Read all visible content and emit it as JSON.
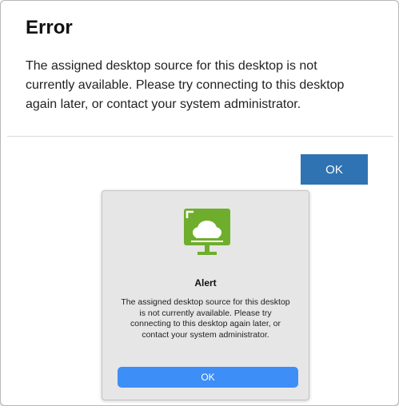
{
  "web_dialog": {
    "title": "Error",
    "message": "The assigned desktop source for this desktop is not currently available. Please try connecting to this desktop again later, or contact your system administrator.",
    "ok_label": "OK"
  },
  "mac_alert": {
    "icon": "desktop-cloud-icon",
    "title": "Alert",
    "message": "The assigned desktop source for this desktop is not currently available. Please try connecting to this desktop again later, or contact your system administrator.",
    "ok_label": "OK"
  },
  "colors": {
    "web_ok_button": "#2f73b3",
    "mac_ok_button": "#3d8ef7",
    "icon_green": "#6fae2c"
  }
}
